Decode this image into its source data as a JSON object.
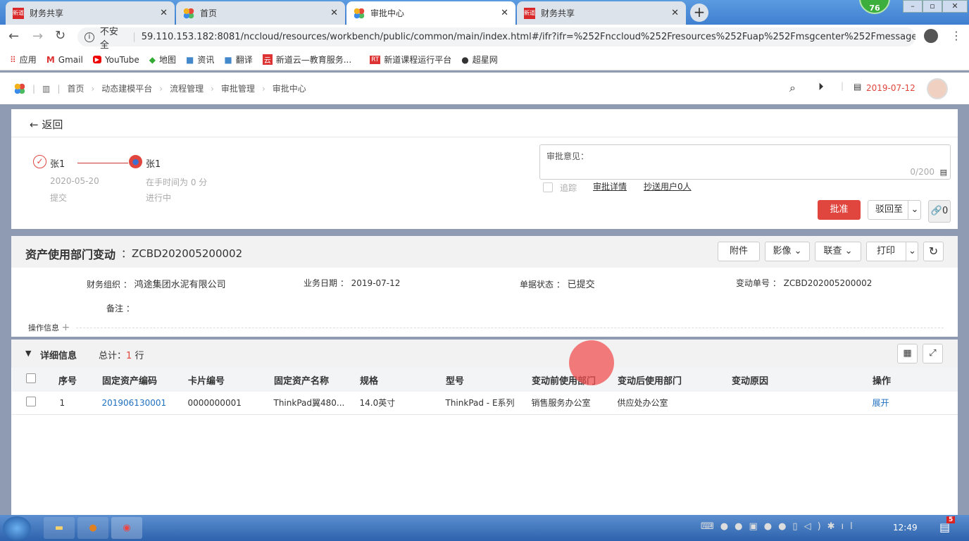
{
  "browser": {
    "tabs": [
      {
        "title": "财务共享",
        "icon": "xindao-logo"
      },
      {
        "title": "首页",
        "icon": "nc-logo"
      },
      {
        "title": "审批中心",
        "icon": "nc-logo",
        "active": true
      },
      {
        "title": "财务共享",
        "icon": "xindao-logo"
      }
    ],
    "security_label": "不安全",
    "url": "59.110.153.182:8081/nccloud/resources/workbench/public/common/main/index.html#/ifr?ifr=%252Fnccloud%252Fresources%252Fuap%252Fmsgcenter%252Fmessage...",
    "badge": "76",
    "bookmarks": [
      "应用",
      "Gmail",
      "YouTube",
      "地图",
      "资讯",
      "翻译",
      "新道云—教育服务...",
      "新道课程运行平台",
      "超星网"
    ]
  },
  "app": {
    "breadcrumb": [
      "首页",
      "动态建模平台",
      "流程管理",
      "审批管理",
      "审批中心"
    ],
    "date": "2019-07-12"
  },
  "approval": {
    "back": "返回",
    "steps": [
      {
        "name": "张1",
        "line1": "2020-05-20",
        "line2": "提交",
        "status": "done"
      },
      {
        "name": "张1",
        "line1": "在手时间为 0 分",
        "line2": "进行中",
        "status": "current"
      }
    ],
    "opinion_label": "审批意见：",
    "opinion_count": "0/200",
    "track": "追踪",
    "detail_link": "审批详情",
    "cc_link": "抄送用户0人",
    "approve": "批准",
    "reject": "驳回至",
    "attach_count": "0",
    "accent": "#e0463e"
  },
  "bill": {
    "title": "资产使用部门变动",
    "code": "：ZCBD202005200002",
    "buttons": [
      "附件",
      "影像",
      "联查",
      "打印"
    ],
    "fields": [
      {
        "label": "财务组织",
        "value": "鸿途集团水泥有限公司"
      },
      {
        "label": "业务日期",
        "value": "2019-07-12"
      },
      {
        "label": "单据状态",
        "value": "已提交"
      },
      {
        "label": "变动单号",
        "value": "ZCBD202005200002"
      },
      {
        "label": "备注",
        "value": ""
      }
    ],
    "op_info": "操作信息"
  },
  "detail": {
    "title": "详细信息",
    "total_label": "总计：",
    "total_count": "1",
    "total_unit": "行",
    "columns": [
      "序号",
      "固定资产编码",
      "卡片编号",
      "固定资产名称",
      "规格",
      "型号",
      "变动前使用部门",
      "变动后使用部门",
      "变动原因",
      "操作"
    ],
    "rows": [
      [
        "1",
        "201906130001",
        "0000000001",
        "ThinkPad翼480...",
        "14.0英寸",
        "ThinkPad - E系列",
        "销售服务办公室",
        "供应处办公室",
        "",
        "展开"
      ]
    ]
  },
  "taskbar": {
    "time": "12:49",
    "notif": "5"
  }
}
